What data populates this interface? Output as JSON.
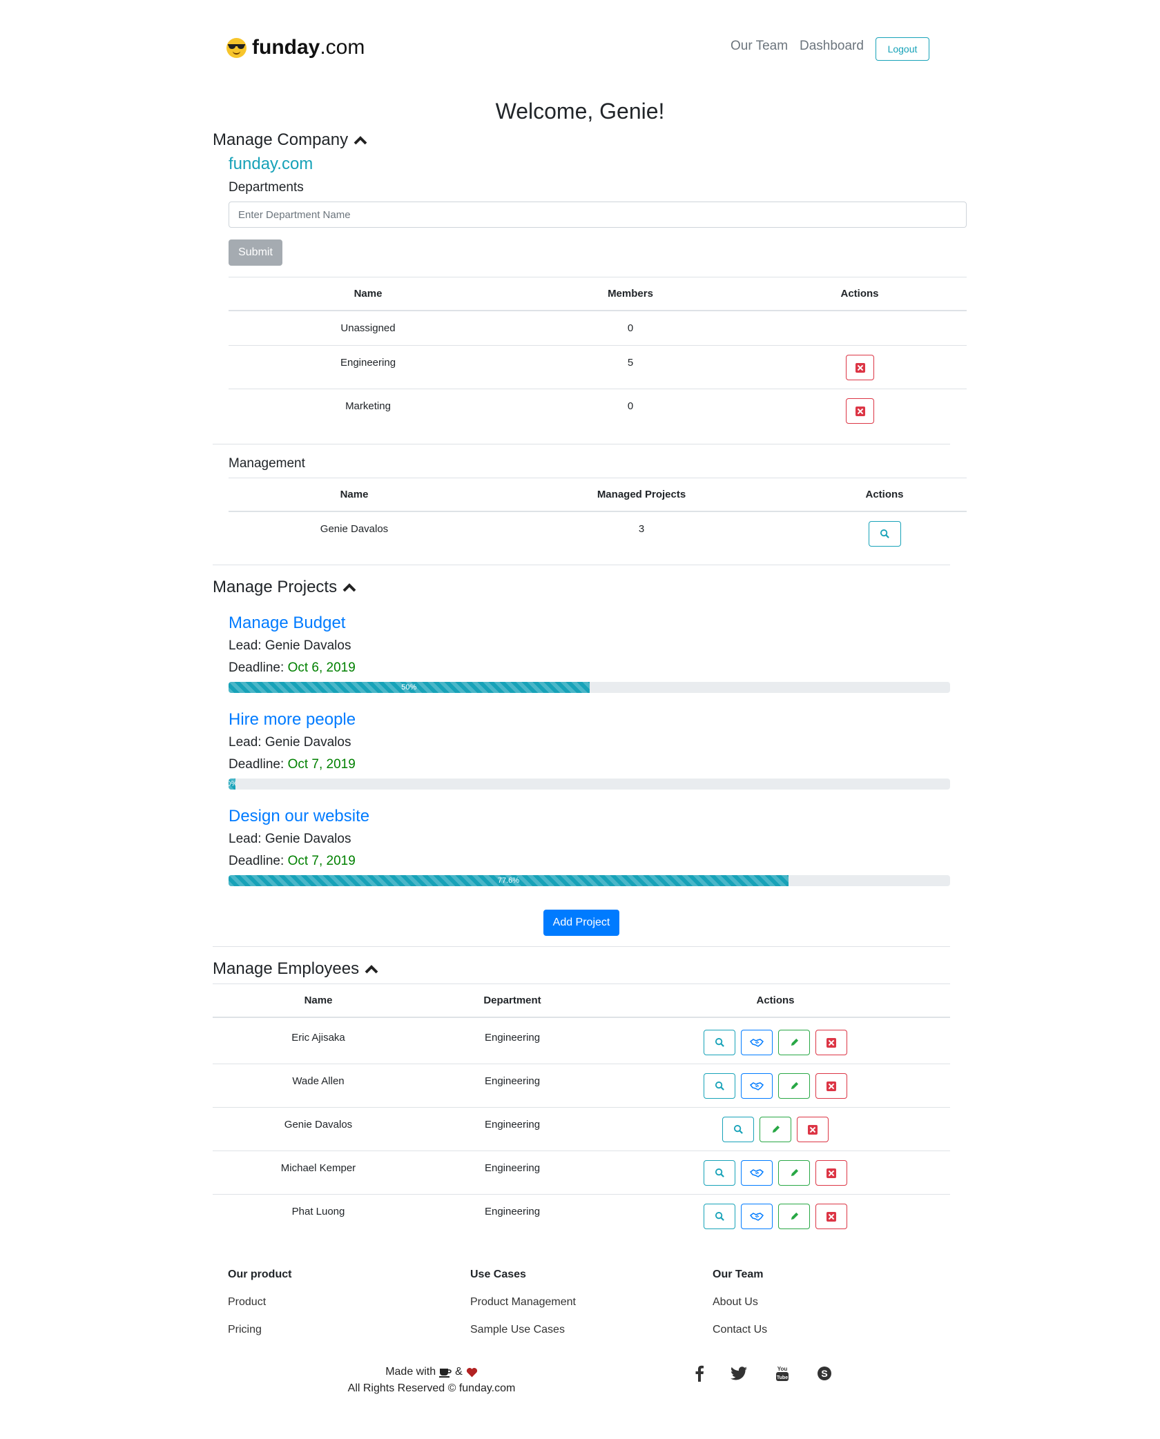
{
  "header": {
    "brand_bold": "funday",
    "brand_rest": ".com",
    "nav": {
      "team": "Our Team",
      "dashboard": "Dashboard",
      "logout": "Logout"
    }
  },
  "welcome": "Welcome, Genie!",
  "company": {
    "section_title": "Manage Company",
    "company_name": "funday.com",
    "departments_label": "Departments",
    "input_placeholder": "Enter Department Name",
    "submit_label": "Submit",
    "dept_table": {
      "headers": [
        "Name",
        "Members",
        "Actions"
      ],
      "rows": [
        {
          "name": "Unassigned",
          "members": "0",
          "deletable": false
        },
        {
          "name": "Engineering",
          "members": "5",
          "deletable": true
        },
        {
          "name": "Marketing",
          "members": "0",
          "deletable": true
        }
      ]
    },
    "management_label": "Management",
    "mgmt_table": {
      "headers": [
        "Name",
        "Managed Projects",
        "Actions"
      ],
      "rows": [
        {
          "name": "Genie Davalos",
          "projects": "3"
        }
      ]
    }
  },
  "projects": {
    "section_title": "Manage Projects",
    "lead_prefix": "Lead: ",
    "deadline_prefix": "Deadline: ",
    "items": [
      {
        "title": "Manage Budget",
        "lead": "Genie Davalos",
        "deadline": "Oct 6, 2019",
        "progress": 50,
        "progress_label": "50%"
      },
      {
        "title": "Hire more people",
        "lead": "Genie Davalos",
        "deadline": "Oct 7, 2019",
        "progress": 1,
        "progress_label": "0%"
      },
      {
        "title": "Design our website",
        "lead": "Genie Davalos",
        "deadline": "Oct 7, 2019",
        "progress": 77.6,
        "progress_label": "77.6%"
      }
    ],
    "add_label": "Add Project"
  },
  "employees": {
    "section_title": "Manage Employees",
    "headers": [
      "Name",
      "Department",
      "Actions"
    ],
    "rows": [
      {
        "name": "Eric Ajisaka",
        "department": "Engineering",
        "can_promote": true
      },
      {
        "name": "Wade Allen",
        "department": "Engineering",
        "can_promote": true
      },
      {
        "name": "Genie Davalos",
        "department": "Engineering",
        "can_promote": false
      },
      {
        "name": "Michael Kemper",
        "department": "Engineering",
        "can_promote": true
      },
      {
        "name": "Phat Luong",
        "department": "Engineering",
        "can_promote": true
      }
    ]
  },
  "footer": {
    "columns": [
      {
        "heading": "Our product",
        "links": [
          "Product",
          "Pricing"
        ]
      },
      {
        "heading": "Use Cases",
        "links": [
          "Product Management",
          "Sample Use Cases"
        ]
      },
      {
        "heading": "Our Team",
        "links": [
          "About Us",
          "Contact Us"
        ]
      }
    ],
    "made_with": "Made with",
    "amp": "&",
    "rights": "All Rights Reserved © funday.com",
    "social": [
      "facebook-icon",
      "twitter-icon",
      "youtube-icon",
      "skype-icon"
    ]
  },
  "colors": {
    "info": "#17a2b8",
    "primary": "#007bff",
    "danger": "#dc3545",
    "success": "#28a745",
    "deadline": "#008000"
  }
}
